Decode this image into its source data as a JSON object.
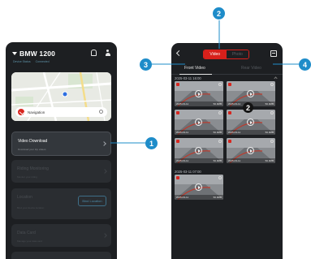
{
  "left_app": {
    "title": "BMW 1200",
    "status": [
      "Device Status",
      "Connected"
    ],
    "map": {
      "navigation_label": "Navigation"
    },
    "cards": [
      {
        "title": "Video Download",
        "subtitle": "Download your trip videos"
      },
      {
        "title": "Riding Monitoring",
        "subtitle": "Monitor your riding"
      },
      {
        "title": "Location",
        "subtitle": "Bind your device location",
        "button": "Bind Location"
      },
      {
        "title": "Data Card",
        "subtitle": "Manage your data card"
      },
      {
        "title": ""
      }
    ]
  },
  "right_app": {
    "segments": [
      "Video",
      "Photo"
    ],
    "tabs": [
      "Front Video",
      "Rear Video"
    ],
    "groups": [
      {
        "date": "2025-03-11 16:00",
        "thumbs": [
          {
            "time": "2025-03-11",
            "size": "50.0MB"
          },
          {
            "time": "2025-03-11",
            "size": "50.0MB"
          },
          {
            "time": "2025-03-11",
            "size": "50.0MB"
          },
          {
            "time": "2025-03-11",
            "size": "50.0MB"
          },
          {
            "time": "2025-03-11",
            "size": "50.0MB"
          },
          {
            "time": "2025-03-11",
            "size": "50.0MB"
          }
        ]
      },
      {
        "date": "2025-03-11 07:00",
        "thumbs": [
          {
            "time": "2025-03-11",
            "size": "50.0MB"
          }
        ]
      }
    ],
    "inline_marker": "2"
  },
  "callouts": [
    "1",
    "2",
    "3",
    "4"
  ],
  "colors": {
    "accent_red": "#d8201b",
    "callout_blue": "#1e8cc9",
    "app_bg": "#1d1f22"
  }
}
